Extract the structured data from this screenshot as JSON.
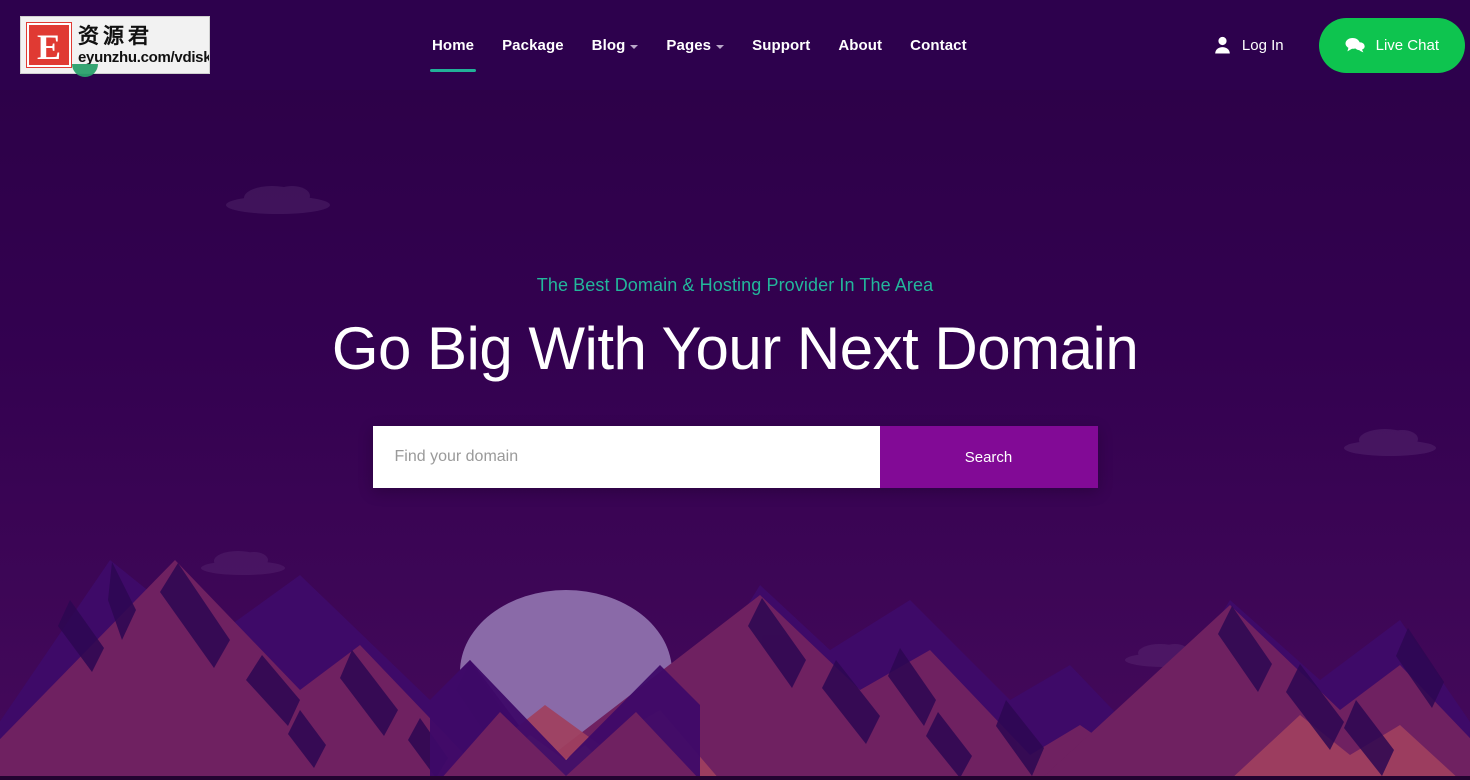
{
  "site": {
    "logo": {
      "letter": "E",
      "chinese": "资源君",
      "url": "eyunzhu.com/vdisk"
    }
  },
  "header": {
    "nav": [
      {
        "label": "Home",
        "icon": "",
        "active": true
      },
      {
        "label": "Package",
        "icon": "",
        "active": false
      },
      {
        "label": "Blog",
        "icon": "chevron-down-icon",
        "active": false
      },
      {
        "label": "Pages",
        "icon": "chevron-down-icon",
        "active": false
      },
      {
        "label": "Support",
        "icon": "",
        "active": false
      },
      {
        "label": "About",
        "icon": "",
        "active": false
      },
      {
        "label": "Contact",
        "icon": "",
        "active": false
      }
    ],
    "login_label": "Log In",
    "login_icon": "person-icon",
    "live_chat_label": "Live Chat",
    "live_chat_icon": "chat-bubbles-icon"
  },
  "hero": {
    "subtitle": "The Best Domain & Hosting Provider In The Area",
    "title": "Go Big With Your Next Domain",
    "search": {
      "placeholder": "Find your domain",
      "value": "",
      "button_label": "Search"
    }
  },
  "colors": {
    "background_top": "#2b0146",
    "background_bottom": "#440559",
    "header_bg": "#2d014d",
    "accent_teal": "#23b79b",
    "accent_green": "#0ec44f",
    "search_button": "#820a96",
    "moon": "#8a6aa8",
    "mountain_dark": "#3d0a66",
    "mountain_mid": "#6e2060",
    "mountain_warm": "#a6456a"
  },
  "scenery": {
    "moon_label": "moon",
    "clouds": 4,
    "mountains_label": "mountain-range"
  }
}
